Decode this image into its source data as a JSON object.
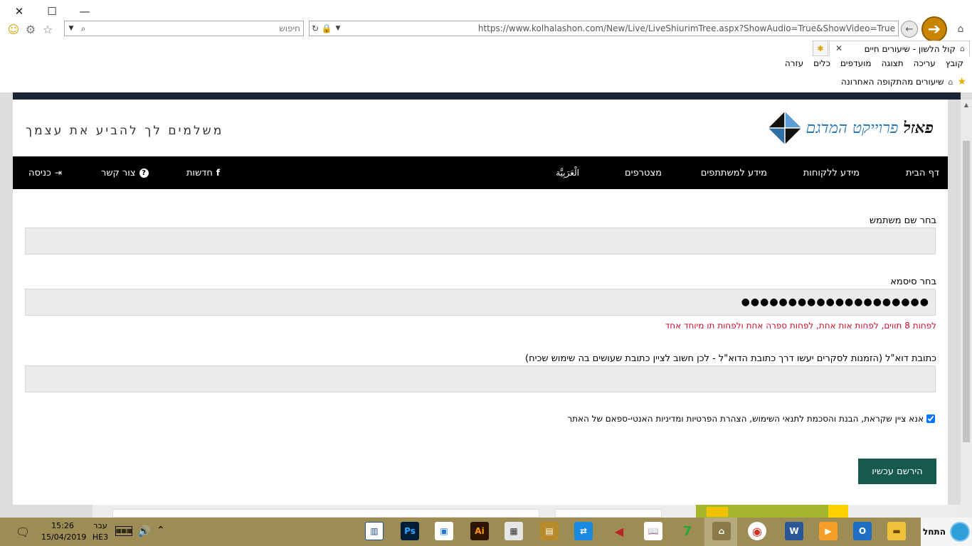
{
  "browser": {
    "address_url": "https://www.kolhalashon.com/New/Live/LiveShiurimTree.aspx?ShowAudio=True&ShowVideo=True",
    "search_placeholder": "חיפוש",
    "tab_title": "קול הלשון - שיעורים חיים",
    "menu": [
      "קובץ",
      "עריכה",
      "תצוגה",
      "מועדפים",
      "כלים",
      "עזרה"
    ],
    "favorites_item": "שיעורים מהתקופה האחרונה"
  },
  "site": {
    "logo_first": "פאזל",
    "logo_rest": "פרוייקט המדגם",
    "tagline": "משלמים לך להביע את עצמך",
    "nav": {
      "home": "דף הבית",
      "clients": "מידע ללקוחות",
      "partners": "מידע למשתתפים",
      "join": "מצטרפים",
      "arabic": "الْعَرَبِيَّة",
      "news": "חדשות",
      "contact": "צור קשר",
      "login": "כניסה"
    }
  },
  "form": {
    "username_label": "בחר שם משתמש",
    "username_value": "",
    "password_label": "בחר סיסמא",
    "password_value": "●●●●●●●●●●●●●●●●●●●●",
    "password_hint": "לפחות 8 תווים, לפחות אות אחת, לפחות ספרה אחת ולפחות תו מיוחד אחד",
    "email_label": "כתובת דוא\"ל (הזמנות לסקרים יעשו דרך כתובת הדוא\"ל - לכן חשוב לציין כתובת שעושים בה שימוש שכיח)",
    "email_value": "",
    "terms_text": "אנא ציין שקראת, הבנת והסכמת לתנאי השימוש, הצהרת הפרטיות ומדיניות האנטי-ספאם של האתר",
    "terms_checked": true,
    "register_label": "הירשם עכשיו"
  },
  "taskbar": {
    "start_label": "התחל",
    "time": "15:26",
    "date": "15/04/2019",
    "lang_top": "עבר",
    "lang_bottom": "HE3"
  },
  "colors": {
    "accent_green": "#165a4f",
    "hint_red": "#c8102e",
    "logo_blue": "#2a79b5",
    "taskbar": "#9d8c53"
  }
}
